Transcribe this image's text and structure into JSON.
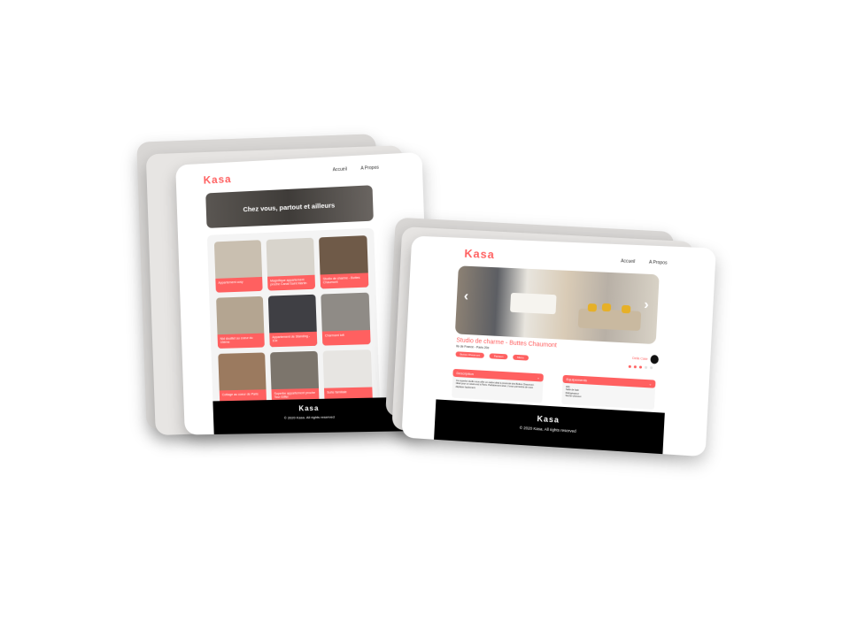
{
  "home_page": {
    "logo": "Kasa",
    "nav": [
      "Accueil",
      "A Propos"
    ],
    "banner_text": "Chez vous, partout et ailleurs",
    "listings": [
      {
        "title": "Appartement cosy",
        "color": "#c9bfb0"
      },
      {
        "title": "Magnifique appartement proche Canal Saint Martin",
        "color": "#d8d4cc"
      },
      {
        "title": "Studio de charme - Buttes Chaumont",
        "color": "#6f5a48"
      },
      {
        "title": "Nid douillet au coeur du 15ème",
        "color": "#b4a591"
      },
      {
        "title": "Appartement de Standing - 10e",
        "color": "#3f3f44"
      },
      {
        "title": "Charmant loft",
        "color": "#8f8b86"
      },
      {
        "title": "Cottage au coeur de Paris",
        "color": "#9b7a5f"
      },
      {
        "title": "Superbe appartement proche Tour Eiffel",
        "color": "#7c756c"
      },
      {
        "title": "Suite familiale",
        "color": "#e7e5e2"
      }
    ],
    "footer_logo": "Kasa",
    "footer_copyright": "© 2020 Kasa. All rights reserved"
  },
  "listing_page": {
    "logo": "Kasa",
    "nav": [
      "Accueil",
      "A Propos"
    ],
    "title": "Studio de charme - Buttes Chaumont",
    "location": "Ile de France - Paris 20e",
    "tags": [
      "Buttes Chaumont",
      "Parisien",
      "Metro"
    ],
    "host_name": "Della Case",
    "rating": 3,
    "rating_max": 5,
    "description": {
      "label": "Description",
      "text": "Ce superbe studio vous offre un cadre idéal à proximité des Buttes Chaumont. Idéal pour un week-end à Paris. Parfaitement situé, il vous permettra de vous déplacer facilement."
    },
    "equipments": {
      "label": "Equipements",
      "items": [
        "Wifi",
        "Salle de bain",
        "Réfrigérateur",
        "Sèche-cheveux"
      ]
    },
    "footer_logo": "Kasa",
    "footer_copyright": "© 2020 Kasa. All rights reserved"
  },
  "colors": {
    "accent": "#ff6060",
    "footer": "#000000",
    "card_stack_back": "#d9d7d5"
  }
}
